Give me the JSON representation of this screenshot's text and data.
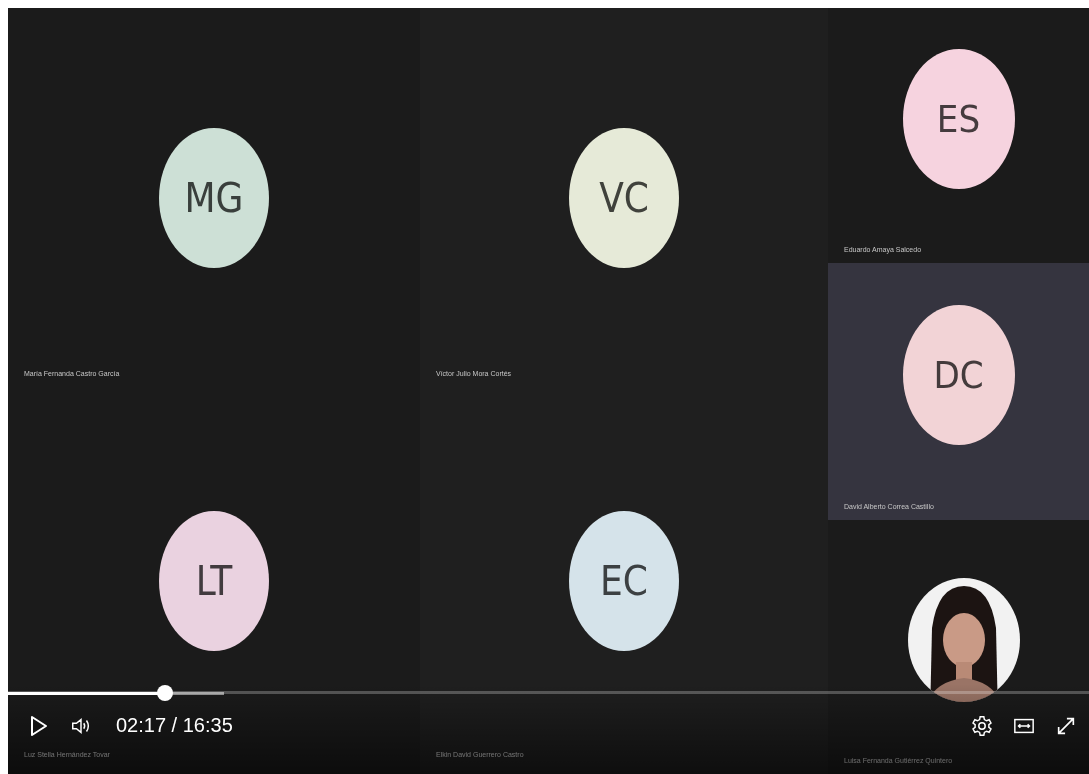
{
  "grid_tiles": [
    {
      "kind": "avatar",
      "initials": "MG",
      "name": "María Fernanda Castro García",
      "color": "#cde0d6",
      "highlighted": false
    },
    {
      "kind": "avatar",
      "initials": "VC",
      "name": "Víctor Julio Mora Cortés",
      "color": "#e6ead8",
      "highlighted": false
    },
    {
      "kind": "avatar",
      "initials": "LT",
      "name": "Luz Stella Hernández Tovar",
      "color": "#ead2e0",
      "highlighted": false
    },
    {
      "kind": "avatar",
      "initials": "EC",
      "name": "Elkin David Guerrero Castro",
      "color": "#d5e3ea",
      "highlighted": false
    }
  ],
  "side_tiles": [
    {
      "kind": "avatar",
      "initials": "ES",
      "name": "Eduardo Amaya Salcedo",
      "color": "#f6d3df",
      "highlighted": false
    },
    {
      "kind": "avatar",
      "initials": "DC",
      "name": "David Alberto Correa Castillo",
      "color": "#f2d3d6",
      "highlighted": true
    },
    {
      "kind": "picture",
      "name": "Luisa Fernanda Gutiérrez Quintero",
      "highlighted": false
    }
  ],
  "player": {
    "progress": {
      "level": 0.145
    },
    "buffer": {
      "level": 0.2
    },
    "time": "02:17 / 16:35"
  }
}
